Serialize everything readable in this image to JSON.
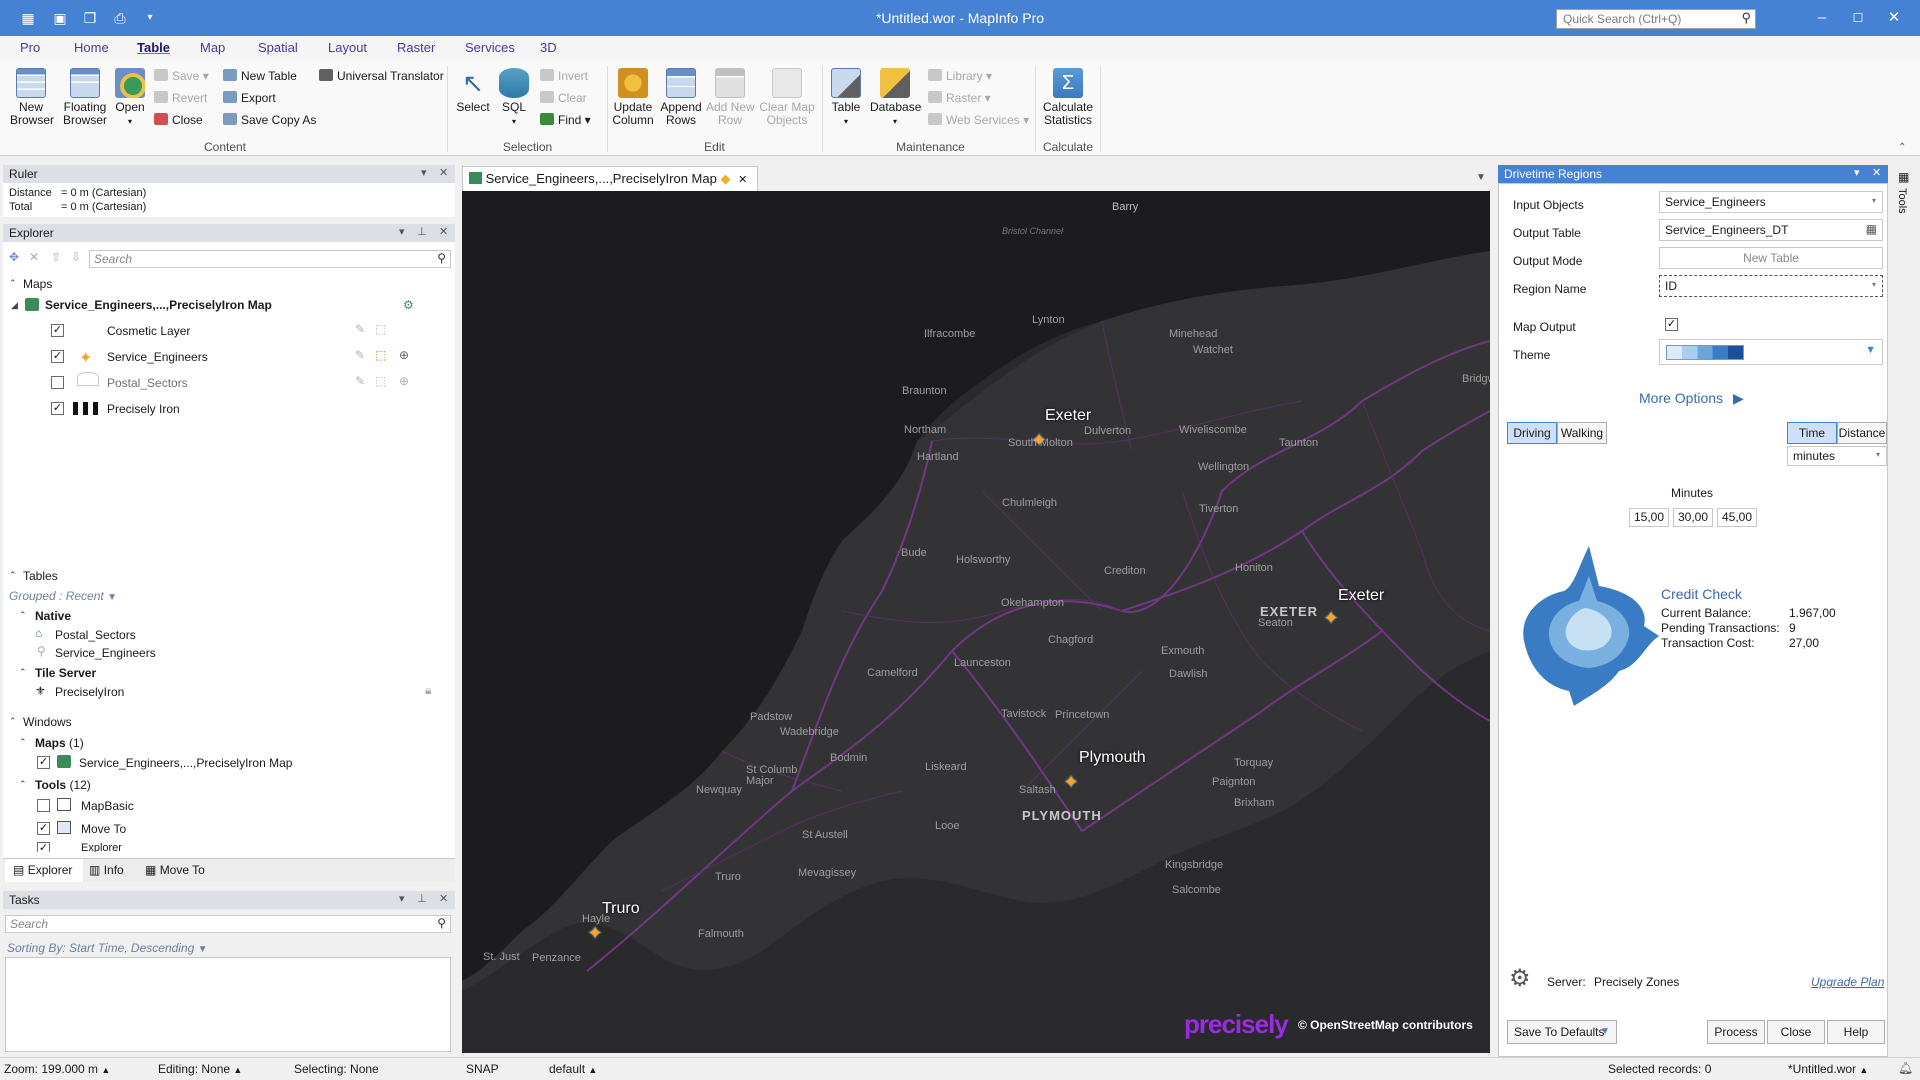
{
  "app": {
    "title": "*Untitled.wor - MapInfo Pro",
    "quick_search_placeholder": "Quick Search (Ctrl+Q)",
    "colors": {
      "titlebar": "#4682d4",
      "map_bg": "#2a2a2c",
      "road": "#8a3fa0",
      "accent_star": "#f5a623",
      "brand": "#8a2be2"
    }
  },
  "ribbon": {
    "tabs": [
      "Pro",
      "Home",
      "Table",
      "Map",
      "Spatial",
      "Layout",
      "Raster",
      "Services",
      "3D"
    ],
    "active_tab": "Table",
    "content": {
      "new_browser": "New\nBrowser",
      "floating_browser": "Floating\nBrowser",
      "open": "Open",
      "save": "Save",
      "revert": "Revert",
      "close": "Close",
      "new_table": "New Table",
      "export": "Export",
      "save_copy_as": "Save Copy As",
      "universal_translator": "Universal Translator",
      "group": "Content"
    },
    "selection": {
      "select": "Select",
      "sql": "SQL",
      "invert": "Invert",
      "clear": "Clear",
      "find": "Find",
      "group": "Selection"
    },
    "edit": {
      "update_column": "Update\nColumn",
      "append_rows": "Append\nRows",
      "add_new_row": "Add New\nRow",
      "clear_map_objects": "Clear Map\nObjects",
      "group": "Edit"
    },
    "maintenance": {
      "table": "Table",
      "database": "Database",
      "library": "Library",
      "raster": "Raster",
      "web_services": "Web Services",
      "group": "Maintenance"
    },
    "calculate": {
      "calculate_statistics": "Calculate\nStatistics",
      "group": "Calculate"
    }
  },
  "ruler": {
    "title": "Ruler",
    "distance_label": "Distance",
    "distance_value": "= 0 m (Cartesian)",
    "total_label": "Total",
    "total_value": "= 0 m (Cartesian)"
  },
  "explorer": {
    "title": "Explorer",
    "search_placeholder": "Search",
    "maps_header": "Maps",
    "map_name": "Service_Engineers,...,PreciselyIron Map",
    "layers": [
      {
        "name": "Cosmetic Layer",
        "checked": true
      },
      {
        "name": "Service_Engineers",
        "checked": true
      },
      {
        "name": "Postal_Sectors",
        "checked": false
      },
      {
        "name": "Precisely Iron",
        "checked": true
      }
    ],
    "tables_header": "Tables",
    "grouped": "Grouped : Recent",
    "native_header": "Native",
    "native_tables": [
      "Postal_Sectors",
      "Service_Engineers"
    ],
    "tile_server_header": "Tile Server",
    "tile_tables": [
      "PreciselyIron"
    ],
    "windows_header": "Windows",
    "maps_group": "Maps",
    "maps_count": "(1)",
    "maps_window": "Service_Engineers,...,PreciselyIron Map",
    "tools_group": "Tools",
    "tools_count": "(12)",
    "tools": [
      {
        "name": "MapBasic",
        "checked": false
      },
      {
        "name": "Move To",
        "checked": true
      },
      {
        "name": "Explorer",
        "checked": true
      }
    ],
    "bottom_tabs": [
      "Explorer",
      "Info",
      "Move To"
    ]
  },
  "tasks": {
    "title": "Tasks",
    "search_placeholder": "Search",
    "sorting": "Sorting By: Start Time, Descending"
  },
  "map_tab": {
    "title": "Service_Engineers,...,PreciselyIron Map"
  },
  "map": {
    "places": [
      "Barry",
      "Bristol Channel",
      "Lynton",
      "Ilfracombe",
      "Minehead",
      "Watchet",
      "Bridgwa",
      "Braunton",
      "Northam",
      "Dulverton",
      "Wiveliscombe",
      "Taunton",
      "Hartland",
      "South Molton",
      "Wellington",
      "Chulmleigh",
      "Tiverton",
      "Bude",
      "Holsworthy",
      "Crediton",
      "Honiton",
      "Okehampton",
      "Seaton",
      "Chagford",
      "Exmouth",
      "Camelford",
      "Launceston",
      "Dawlish",
      "Padstow",
      "Wadebridge",
      "Tavistock",
      "Princetown",
      "Bodmin",
      "St Columb\nMajor",
      "Liskeard",
      "Newquay",
      "Saltash",
      "Torquay",
      "Paignton",
      "Brixham",
      "Looe",
      "St Austell",
      "Mevagissey",
      "Kingsbridge",
      "Salcombe",
      "Truro",
      "Hayle",
      "Falmouth",
      "Penzance",
      "St. Just"
    ],
    "cities": [
      "Exeter",
      "Exeter",
      "Plymouth",
      "Truro"
    ],
    "big_labels": [
      "EXETER",
      "PLYMOUTH"
    ],
    "brand": "precisely",
    "attribution": "© OpenStreetMap contributors"
  },
  "drivetime": {
    "title": "Drivetime Regions",
    "input_objects_label": "Input Objects",
    "input_objects_value": "Service_Engineers",
    "output_table_label": "Output Table",
    "output_table_value": "Service_Engineers_DT",
    "output_mode_label": "Output Mode",
    "output_mode_value": "New Table",
    "region_name_label": "Region Name",
    "region_name_value": "ID",
    "map_output_label": "Map Output",
    "map_output_checked": true,
    "theme_label": "Theme",
    "more_options": "More Options",
    "driving": "Driving",
    "walking": "Walking",
    "time": "Time",
    "distance": "Distance",
    "unit": "minutes",
    "minutes_label": "Minutes",
    "intervals": [
      "15,00",
      "30,00",
      "45,00"
    ],
    "credit_title": "Credit Check",
    "current_balance_label": "Current Balance:",
    "current_balance": "1.967,00",
    "pending_label": "Pending Transactions:",
    "pending": "9",
    "cost_label": "Transaction Cost:",
    "cost": "27,00",
    "server_label": "Server:",
    "server_value": "Precisely Zones",
    "upgrade_plan": "Upgrade Plan",
    "save_defaults": "Save To Defaults",
    "process": "Process",
    "close": "Close",
    "help": "Help",
    "side_tab": "Tools"
  },
  "status": {
    "zoom": "Zoom: 199.000 m",
    "editing": "Editing: None",
    "selecting": "Selecting: None",
    "snap": "SNAP",
    "projection": "default",
    "selected_records": "Selected records: 0",
    "workspace": "*Untitled.wor"
  }
}
